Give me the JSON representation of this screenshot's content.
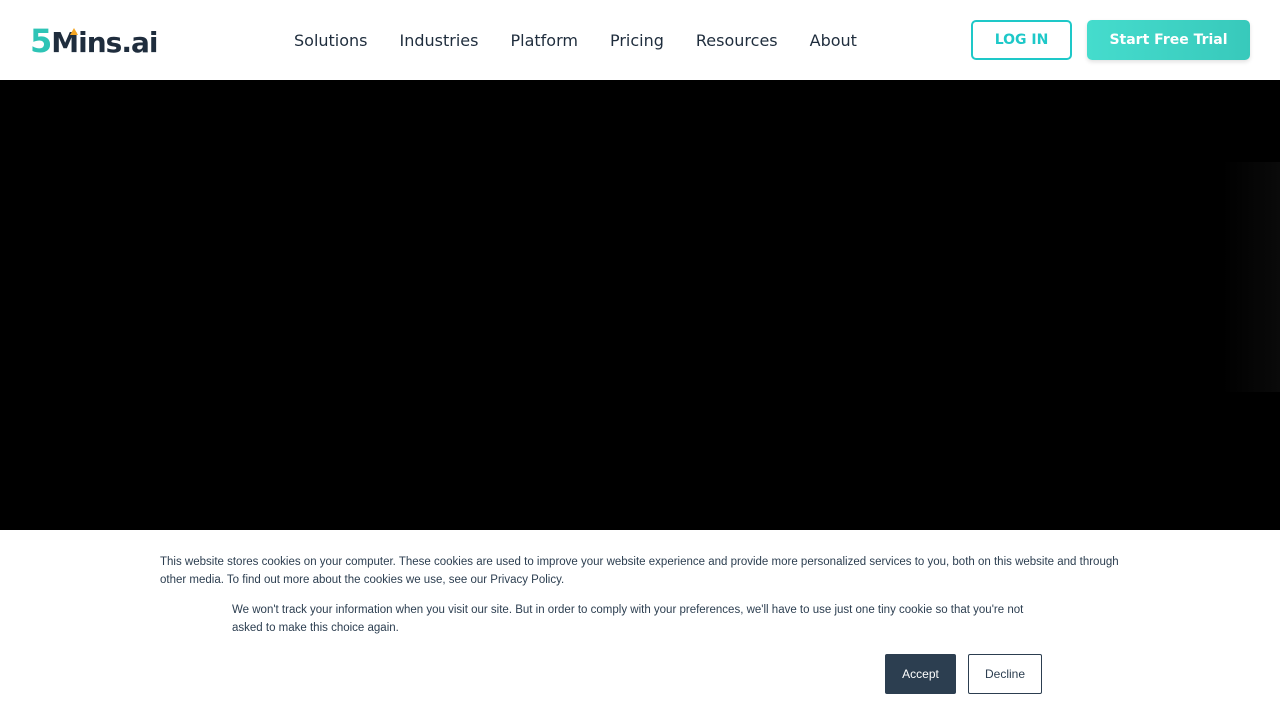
{
  "header": {
    "logo": {
      "five": "5",
      "rest": "Mins.ai"
    },
    "nav": [
      {
        "label": "Solutions"
      },
      {
        "label": "Industries"
      },
      {
        "label": "Platform"
      },
      {
        "label": "Pricing"
      },
      {
        "label": "Resources"
      },
      {
        "label": "About"
      }
    ],
    "login_label": "LOG IN",
    "trial_label": "Start Free Trial"
  },
  "cookie_banner": {
    "text_main": "This website stores cookies on your computer. These cookies are used to improve your website experience and provide more personalized services to you, both on this website and through other media. To find out more about the cookies we use, see our Privacy Policy.",
    "text_secondary": "We won't track your information when you visit our site. But in order to comply with your preferences, we'll have to use just one tiny cookie so that you're not asked to make this choice again.",
    "accept_label": "Accept",
    "decline_label": "Decline"
  },
  "colors": {
    "brand_teal": "#2ec4b6",
    "login_border": "#1ec8c8",
    "trial_bg": "#45dccd",
    "text_dark": "#1f2d3d",
    "accept_bg": "#2c3e50",
    "logo_accent": "#f5a623"
  }
}
